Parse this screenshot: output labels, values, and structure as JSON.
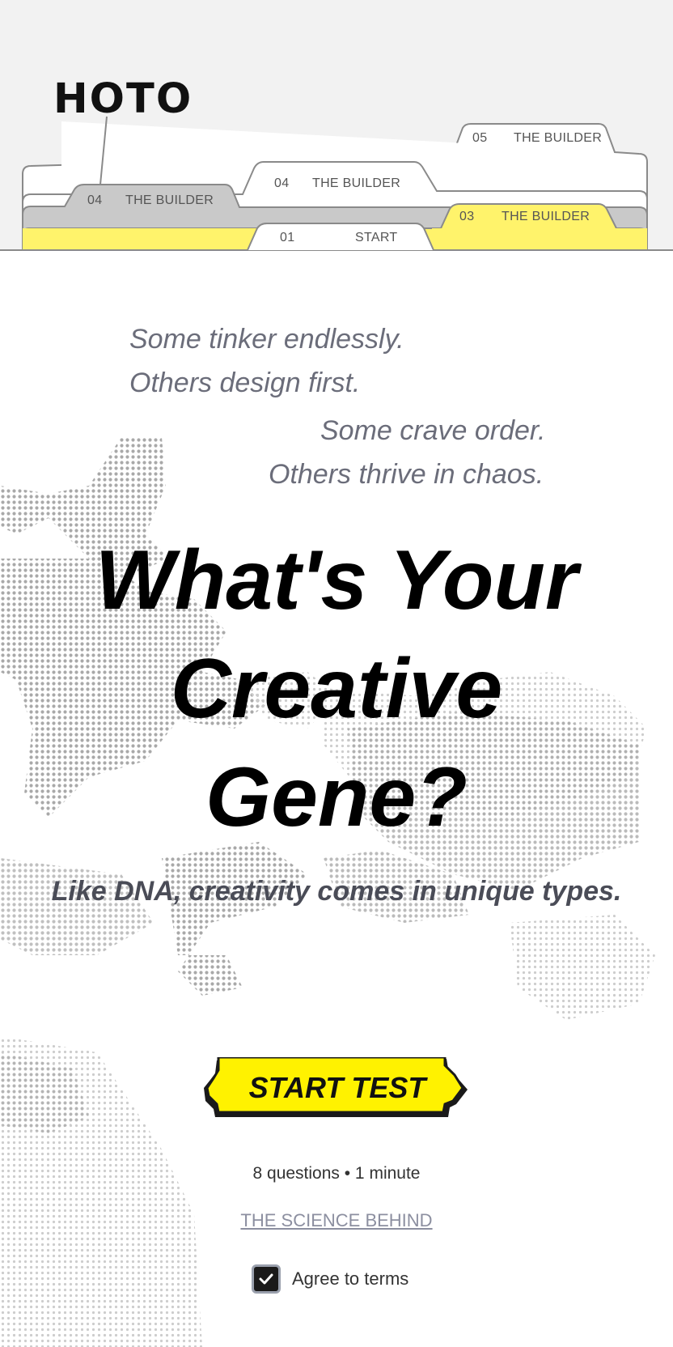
{
  "brand": {
    "logo_text": "HOTO"
  },
  "tabs": [
    {
      "number": "05",
      "label": "THE BUILDER"
    },
    {
      "number": "04",
      "label": "THE BUILDER"
    },
    {
      "number": "04",
      "label": "THE BUILDER"
    },
    {
      "number": "03",
      "label": "THE BUILDER"
    },
    {
      "number": "01",
      "label": "START"
    }
  ],
  "teasers": [
    "Some tinker endlessly.",
    "Others design first.",
    "Some crave order.",
    "Others thrive in chaos."
  ],
  "headline": {
    "line1": "What's Your",
    "line2": "Creative",
    "line3": "Gene?"
  },
  "subheadline": "Like DNA, creativity comes in unique types.",
  "cta": {
    "label": "START TEST"
  },
  "meta": "8 questions • 1 minute",
  "science_link": "THE SCIENCE BEHIND",
  "terms": {
    "label": "Agree to terms",
    "checked": true
  },
  "colors": {
    "accent": "#fff200",
    "tab_yellow": "#fff36b",
    "tab_gray": "#c8c8c8",
    "text_muted": "#6b6d7a"
  }
}
